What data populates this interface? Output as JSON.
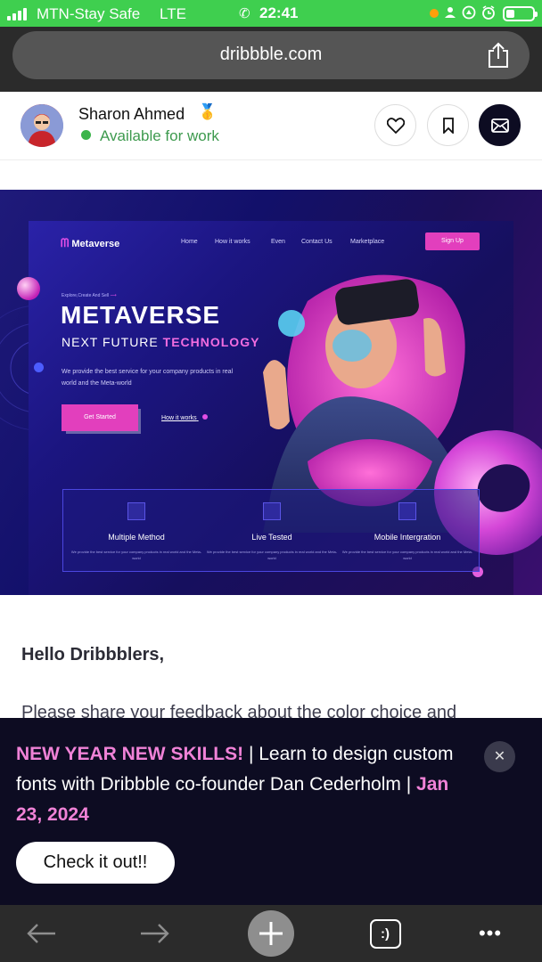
{
  "status_bar": {
    "carrier": "MTN-Stay Safe",
    "network": "LTE",
    "time": "22:41",
    "background": "#3fcf4f"
  },
  "browser": {
    "url": "dribbble.com",
    "share_icon": "share-icon"
  },
  "profile": {
    "name": "Sharon Ahmed",
    "badge": "🥇",
    "status": "Available for work",
    "status_color": "#3d9a4e",
    "actions": [
      "like-icon",
      "bookmark-icon",
      "mail-icon"
    ]
  },
  "shot": {
    "logo": "Metaverse",
    "nav": [
      "Home",
      "How it works",
      "Even",
      "Contact Us",
      "Marketplace"
    ],
    "signup": "Sign Up",
    "eyebrow": "Explore,Create And Sell",
    "title": "METAVERSE",
    "subtitle_a": "NEXT FUTURE",
    "subtitle_b": "TECHNOLOGY",
    "paragraph": "We provide the best service for your company products in real world and the Meta-world",
    "get_started": "Get Started",
    "how_it_works": "How it works",
    "features": [
      {
        "title": "Multiple Method",
        "desc": "We provide the best service for your company products in real world and the Meta-world"
      },
      {
        "title": "Live Tested",
        "desc": "We provide the best service for your company products in real world and the Meta-world"
      },
      {
        "title": "Mobile Intergration",
        "desc": "We provide the best service for your company products in real world and the Meta-world"
      }
    ]
  },
  "article": {
    "greeting": "Hello Dribbblers,",
    "line": "Please share your feedback about the color choice and"
  },
  "banner": {
    "headline": "NEW YEAR NEW SKILLS!",
    "sep1": " | ",
    "text": "Learn to design custom fonts with Dribbble co-founder Dan Cederholm",
    "sep2": " | ",
    "date": "Jan 23, 2024",
    "cta": "Check it out!!",
    "close": "✕",
    "highlight_color": "#f082d7"
  },
  "toolbar": {
    "tabs_label": ":)",
    "more": "•••"
  }
}
